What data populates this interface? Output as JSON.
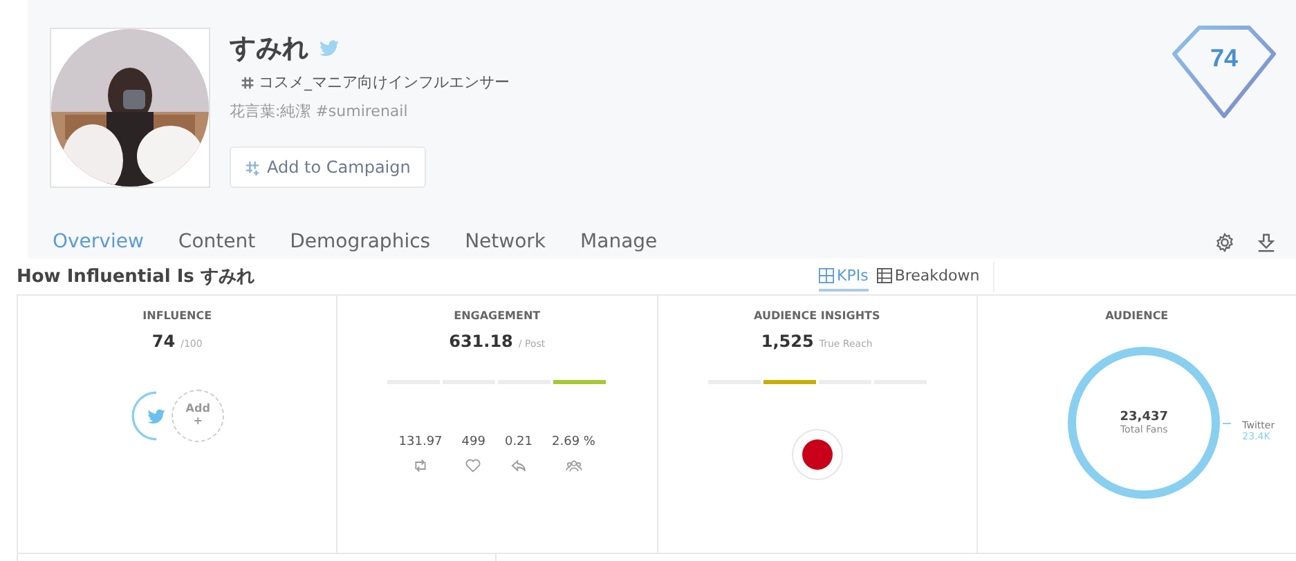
{
  "profile": {
    "name": "すみれ",
    "category": "コスメ_マニア向けインフルエンサー",
    "bio": "花言葉:純潔 #sumirenail",
    "add_button": "Add to Campaign",
    "score": "74"
  },
  "tabs": [
    {
      "label": "Overview",
      "selected": true
    },
    {
      "label": "Content",
      "selected": false
    },
    {
      "label": "Demographics",
      "selected": false
    },
    {
      "label": "Network",
      "selected": false
    },
    {
      "label": "Manage",
      "selected": false
    }
  ],
  "section": {
    "title": "How Influential Is すみれ"
  },
  "views": [
    {
      "label": "KPIs",
      "selected": true,
      "kind": "grid"
    },
    {
      "label": "Breakdown",
      "selected": false,
      "kind": "table"
    }
  ],
  "cards": [
    {
      "kind": "influence",
      "title": "INFLUENCE",
      "value": "74",
      "unit": "/100",
      "add_label": "Add",
      "add_plus": "+"
    },
    {
      "kind": "engagement",
      "title": "ENGAGEMENT",
      "value": "631.18",
      "unit": "/ Post",
      "color": "#a6c832",
      "segments": [
        {
          "active": false
        },
        {
          "active": false
        },
        {
          "active": false
        },
        {
          "active": true
        }
      ],
      "stats": [
        {
          "value": "131.97",
          "kind": "retweet"
        },
        {
          "value": "499",
          "kind": "like"
        },
        {
          "value": "0.21",
          "kind": "reply"
        },
        {
          "value": "2.69 %",
          "kind": "people"
        }
      ]
    },
    {
      "kind": "insights",
      "title": "AUDIENCE INSIGHTS",
      "value": "1,525",
      "unit": "True Reach",
      "color": "#c9ae00",
      "segments": [
        {
          "active": false
        },
        {
          "active": true
        },
        {
          "active": false
        },
        {
          "active": false
        }
      ]
    },
    {
      "kind": "audience",
      "title": "AUDIENCE",
      "total": "23,437",
      "total_label": "Total Fans",
      "legend_name": "Twitter",
      "legend_value": "23.4K"
    }
  ]
}
